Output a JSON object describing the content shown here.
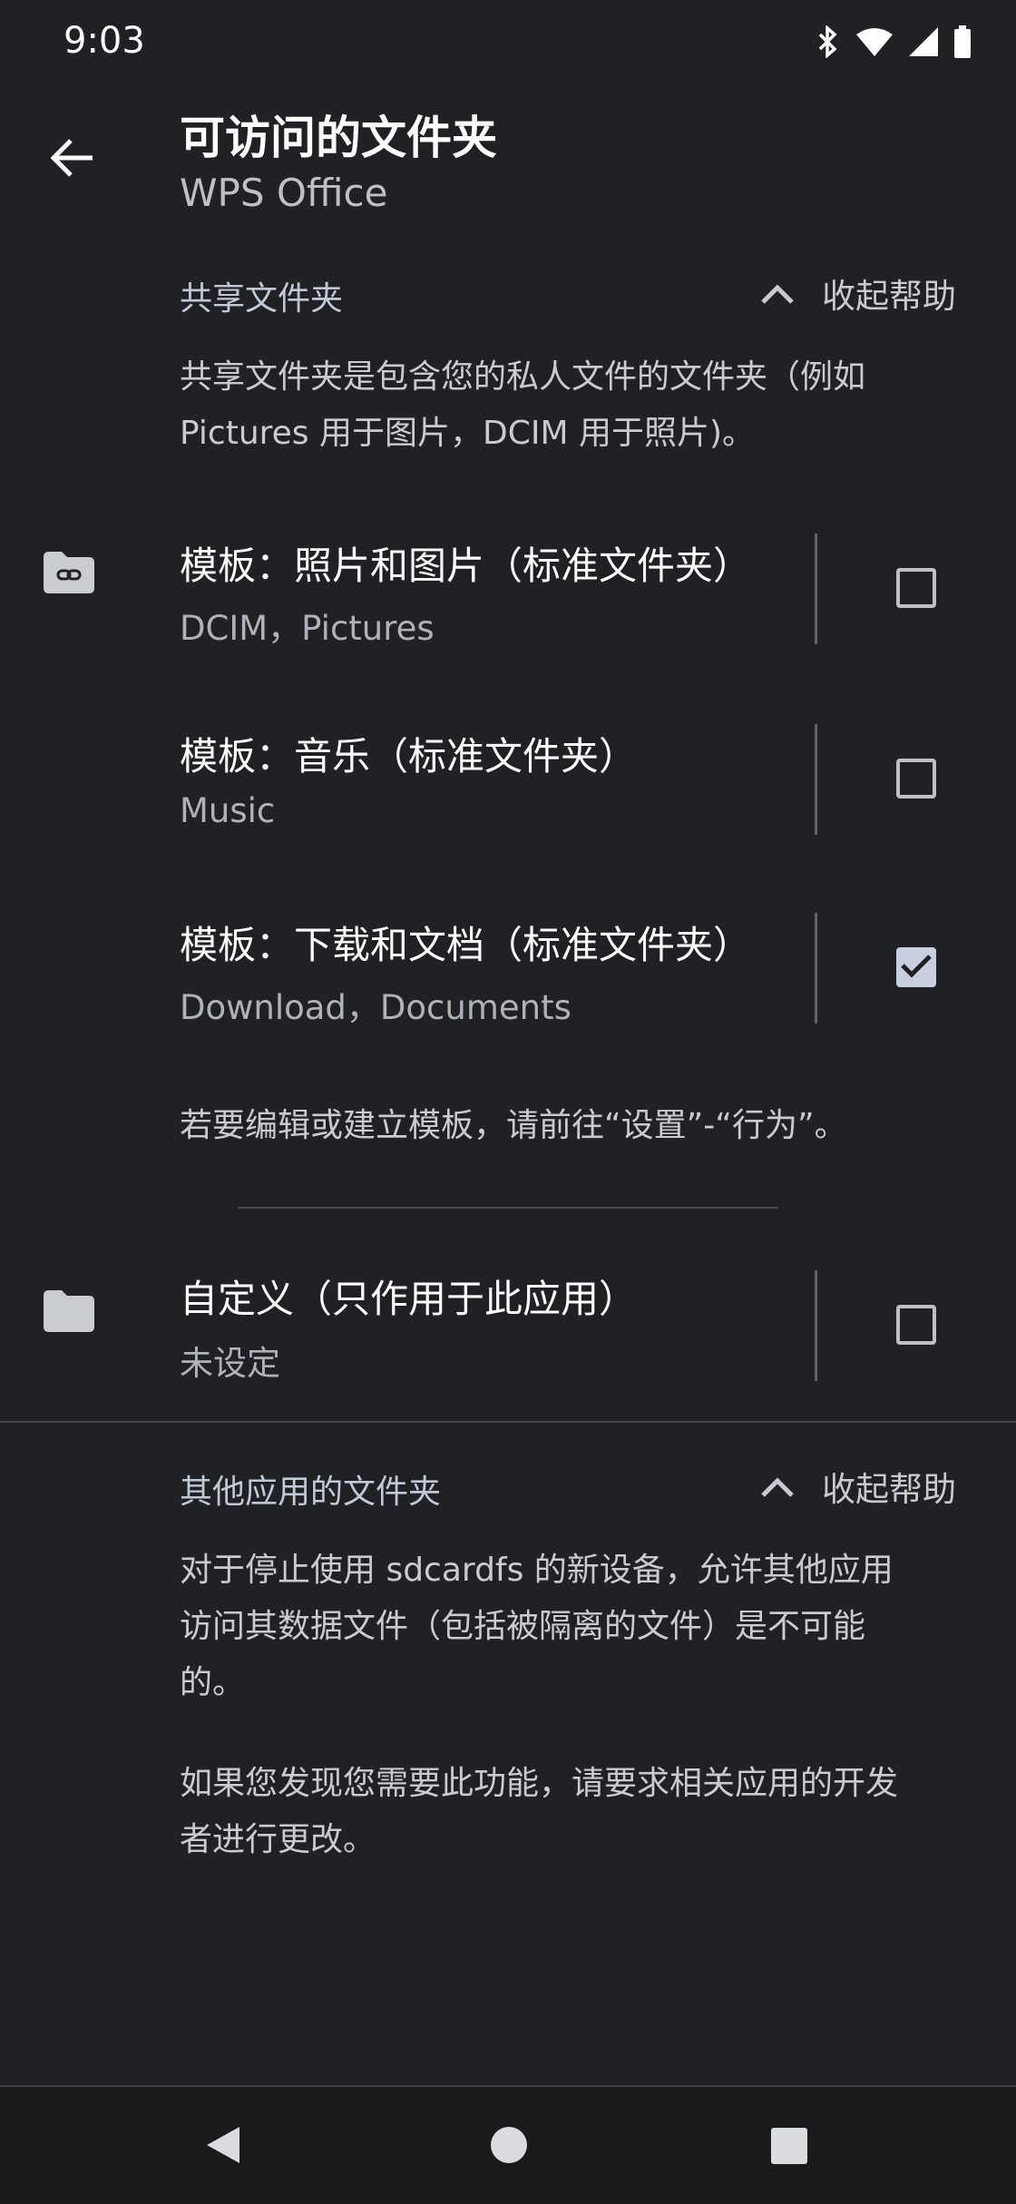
{
  "status_bar": {
    "time": "9:03",
    "icons": [
      "bluetooth-icon",
      "wifi-icon",
      "cell-signal-icon",
      "battery-icon"
    ]
  },
  "header": {
    "title": "可访问的文件夹",
    "subtitle": "WPS Office"
  },
  "shared_section": {
    "heading": "共享文件夹",
    "help_toggle": "收起帮助",
    "help_text_line1": "共享文件夹是包含您的私人文件的文件夹（例如",
    "help_text_line2": "Pictures 用于图片，DCIM 用于照片)。",
    "items": [
      {
        "title": "模板：照片和图片（标准文件夹）",
        "subtitle": "DCIM，Pictures",
        "checked": false
      },
      {
        "title": "模板：音乐（标准文件夹）",
        "subtitle": "Music",
        "checked": false
      },
      {
        "title": "模板：下载和文档（标准文件夹）",
        "subtitle": "Download，Documents",
        "checked": true
      }
    ],
    "footnote": "若要编辑或建立模板，请前往“设置”-“行为”。"
  },
  "custom_item": {
    "title": "自定义（只作用于此应用）",
    "subtitle": "未设定",
    "checked": false
  },
  "other_section": {
    "heading": "其他应用的文件夹",
    "help_toggle": "收起帮助",
    "para1_line1": "对于停止使用 sdcardfs 的新设备，允许其他应用",
    "para1_line2": "访问其数据文件（包括被隔离的文件）是不可能",
    "para1_line3": "的。",
    "para2_line1": "如果您发现您需要此功能，请要求相关应用的开发",
    "para2_line2": "者进行更改。"
  },
  "colors": {
    "background": "#202124",
    "checkbox_checked": "#c7cfe0"
  }
}
